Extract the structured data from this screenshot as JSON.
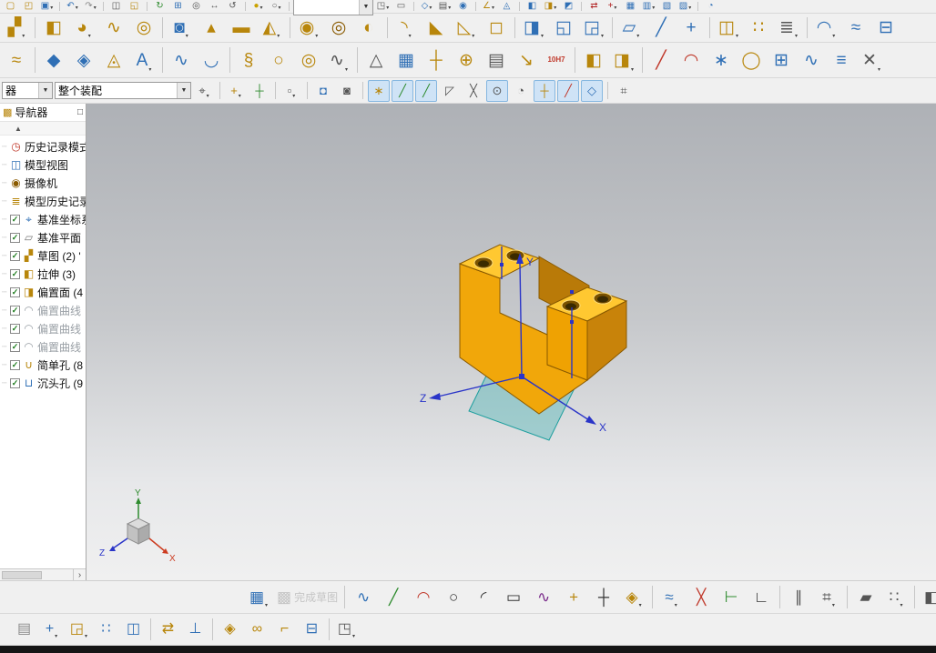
{
  "navigator": {
    "title": "导航器",
    "maximize_glyph": "□",
    "collapse_glyph": "▲",
    "check_glyph": "✓",
    "scroll_right_glyph": "›",
    "header_icon": "▩",
    "items": [
      {
        "name": "history-mode",
        "label": "历史记录模式",
        "glyph": "◷",
        "color": "#c0392b",
        "check": false,
        "gray": false
      },
      {
        "name": "model-views",
        "label": "模型视图",
        "glyph": "◫",
        "color": "#2f6fb5",
        "check": false,
        "gray": false
      },
      {
        "name": "cameras",
        "label": "摄像机",
        "glyph": "◉",
        "color": "#8a5a00",
        "check": false,
        "gray": false
      },
      {
        "name": "model-history",
        "label": "模型历史记录",
        "glyph": "≣",
        "color": "#b8860b",
        "check": false,
        "gray": false
      },
      {
        "name": "datum-csys",
        "label": "基准坐标系",
        "glyph": "⌖",
        "color": "#2f6fb5",
        "check": true,
        "gray": false
      },
      {
        "name": "datum-plane",
        "label": "基准平面",
        "glyph": "▱",
        "color": "#7a7a7a",
        "check": true,
        "gray": false
      },
      {
        "name": "sketch",
        "label": "草图 (2) '",
        "glyph": "▞",
        "color": "#b8860b",
        "check": true,
        "gray": false
      },
      {
        "name": "extrude",
        "label": "拉伸 (3)",
        "glyph": "◧",
        "color": "#b8860b",
        "check": true,
        "gray": false
      },
      {
        "name": "offset-face",
        "label": "偏置面 (4",
        "glyph": "◨",
        "color": "#b8860b",
        "check": true,
        "gray": false
      },
      {
        "name": "offset-curve-1",
        "label": "偏置曲线",
        "glyph": "◠",
        "color": "#9aa0a6",
        "check": true,
        "gray": true
      },
      {
        "name": "offset-curve-2",
        "label": "偏置曲线",
        "glyph": "◠",
        "color": "#9aa0a6",
        "check": true,
        "gray": true
      },
      {
        "name": "offset-curve-3",
        "label": "偏置曲线",
        "glyph": "◠",
        "color": "#9aa0a6",
        "check": true,
        "gray": true
      },
      {
        "name": "simple-hole",
        "label": "简单孔 (8",
        "glyph": "∪",
        "color": "#b8860b",
        "check": true,
        "gray": false
      },
      {
        "name": "counterbore-hole",
        "label": "沉头孔 (9",
        "glyph": "⊔",
        "color": "#2f6fb5",
        "check": true,
        "gray": false
      }
    ]
  },
  "canvas": {
    "axes": {
      "x": "X",
      "y": "Y",
      "z": "Z"
    },
    "triad": {
      "x": "X",
      "y": "Y",
      "z": "Z"
    }
  },
  "toolbars": {
    "row1": {
      "items": [
        {
          "n": "new-icon",
          "g": "▢",
          "c": "#b8860b"
        },
        {
          "n": "open-icon",
          "g": "◰",
          "c": "#b8860b"
        },
        {
          "n": "save-icon",
          "g": "▣",
          "c": "#2f6fb5",
          "dd": true
        },
        {
          "n": "sep"
        },
        {
          "n": "undo-icon",
          "g": "↶",
          "c": "#2f6fb5",
          "dd": true
        },
        {
          "n": "redo-icon",
          "g": "↷",
          "c": "#8a8a8a",
          "dd": true
        },
        {
          "n": "sep"
        },
        {
          "n": "copy-icon",
          "g": "◫",
          "c": "#555555"
        },
        {
          "n": "paste-icon",
          "g": "◱",
          "c": "#b8860b"
        },
        {
          "n": "sep"
        },
        {
          "n": "refresh-icon",
          "g": "↻",
          "c": "#2e8b2e"
        },
        {
          "n": "fit-view-icon",
          "g": "⊞",
          "c": "#2f6fb5"
        },
        {
          "n": "zoom-icon",
          "g": "◎",
          "c": "#555555"
        },
        {
          "n": "pan-icon",
          "g": "↔",
          "c": "#555555"
        },
        {
          "n": "rotate-view-icon",
          "g": "↺",
          "c": "#555555"
        },
        {
          "n": "sep"
        },
        {
          "n": "shaded-view-icon",
          "g": "●",
          "c": "#caa200",
          "dd": true
        },
        {
          "n": "wireframe-view-icon",
          "g": "○",
          "c": "#555555",
          "dd": true
        },
        {
          "n": "sep"
        },
        {
          "n": "quick-search-combo",
          "combo": true,
          "w": 88,
          "text": ""
        },
        {
          "n": "window-icon",
          "g": "◳",
          "c": "#555555",
          "dd": true
        },
        {
          "n": "touch-mode-icon",
          "g": "▭",
          "c": "#555555"
        },
        {
          "n": "sep"
        },
        {
          "n": "datum-icon",
          "g": "◇",
          "c": "#2f6fb5",
          "dd": true
        },
        {
          "n": "layer-icon",
          "g": "▤",
          "c": "#555555",
          "dd": true
        },
        {
          "n": "visibility-icon",
          "g": "◉",
          "c": "#2f6fb5"
        },
        {
          "n": "sep"
        },
        {
          "n": "measure-icon",
          "g": "∠",
          "c": "#b8860b",
          "dd": true
        },
        {
          "n": "analysis-icon",
          "g": "◬",
          "c": "#2f6fb5"
        },
        {
          "n": "sep"
        },
        {
          "n": "blue-cube-icon",
          "g": "◧",
          "c": "#2f6fb5"
        },
        {
          "n": "gold-cube-icon",
          "g": "◨",
          "c": "#b8860b",
          "dd": true
        },
        {
          "n": "part-icon",
          "g": "◩",
          "c": "#2f6fb5"
        },
        {
          "n": "sep"
        },
        {
          "n": "swap-arrows-icon",
          "g": "⇄",
          "c": "#b22222"
        },
        {
          "n": "red-plus-icon",
          "g": "+",
          "c": "#b22222",
          "dd": true
        },
        {
          "n": "grid-blue-icon",
          "g": "▦",
          "c": "#2f6fb5"
        },
        {
          "n": "table-icon",
          "g": "▥",
          "c": "#2f6fb5",
          "dd": true
        },
        {
          "n": "chart-icon",
          "g": "▧",
          "c": "#2f6fb5"
        },
        {
          "n": "notes-icon",
          "g": "▨",
          "c": "#2f6fb5",
          "dd": true
        },
        {
          "n": "sep"
        },
        {
          "n": "help-icon",
          "g": "◔",
          "c": "#2f6fb5"
        }
      ]
    },
    "row2": {
      "items": [
        {
          "n": "direct-sketch-icon",
          "g": "▞",
          "c": "#b8860b",
          "dd": true
        },
        {
          "n": "sep"
        },
        {
          "n": "extrude-icon",
          "g": "◧",
          "c": "#b8860b"
        },
        {
          "n": "revolve-icon",
          "g": "◕",
          "c": "#b8860b",
          "dd": true
        },
        {
          "n": "swept-icon",
          "g": "∿",
          "c": "#b8860b"
        },
        {
          "n": "tube-icon",
          "g": "◎",
          "c": "#b8860b"
        },
        {
          "n": "sep"
        },
        {
          "n": "hole-icon",
          "g": "◙",
          "c": "#2f6fb5",
          "dd": true
        },
        {
          "n": "boss-icon",
          "g": "▴",
          "c": "#b8860b"
        },
        {
          "n": "rib-icon",
          "g": "▬",
          "c": "#b8860b"
        },
        {
          "n": "emboss-icon",
          "g": "◭",
          "c": "#b8860b",
          "dd": true
        },
        {
          "n": "sep"
        },
        {
          "n": "unite-icon",
          "g": "◉",
          "c": "#b8860b",
          "dd": true
        },
        {
          "n": "subtract-icon",
          "g": "◎",
          "c": "#8a5a00"
        },
        {
          "n": "intersect-icon",
          "g": "◐",
          "c": "#b8860b"
        },
        {
          "n": "sep"
        },
        {
          "n": "edge-blend-icon",
          "g": "◝",
          "c": "#b8860b",
          "dd": true
        },
        {
          "n": "chamfer-icon",
          "g": "◣",
          "c": "#b8860b"
        },
        {
          "n": "draft-icon",
          "g": "◺",
          "c": "#b8860b",
          "dd": true
        },
        {
          "n": "shell-icon",
          "g": "◻",
          "c": "#b8860b"
        },
        {
          "n": "sep"
        },
        {
          "n": "offset-face-icon",
          "g": "◨",
          "c": "#2f6fb5",
          "dd": true
        },
        {
          "n": "trim-body-icon",
          "g": "◱",
          "c": "#2f6fb5"
        },
        {
          "n": "split-body-icon",
          "g": "◲",
          "c": "#2f6fb5",
          "dd": true
        },
        {
          "n": "sep"
        },
        {
          "n": "datum-plane-icon",
          "g": "▱",
          "c": "#2f6fb5",
          "dd": true
        },
        {
          "n": "datum-axis-icon",
          "g": "╱",
          "c": "#2f6fb5"
        },
        {
          "n": "point-icon",
          "g": "+",
          "c": "#2f6fb5"
        },
        {
          "n": "sep"
        },
        {
          "n": "mirror-feature-icon",
          "g": "◫",
          "c": "#b8860b",
          "dd": true
        },
        {
          "n": "pattern-feature-icon",
          "g": "∷",
          "c": "#b8860b"
        },
        {
          "n": "more-icon",
          "g": "≣",
          "c": "#555555",
          "dd": true
        },
        {
          "n": "sep"
        },
        {
          "n": "surface-icon",
          "g": "◠",
          "c": "#2f6fb5",
          "dd": true
        },
        {
          "n": "sew-icon",
          "g": "≈",
          "c": "#2f6fb5"
        },
        {
          "n": "thicken-icon",
          "g": "⊟",
          "c": "#2f6fb5"
        }
      ]
    },
    "row3": {
      "items": [
        {
          "n": "sheets-icon",
          "g": "≈",
          "c": "#b8860b"
        },
        {
          "n": "sep"
        },
        {
          "n": "facet-icon",
          "g": "◆",
          "c": "#2f6fb5"
        },
        {
          "n": "xform-icon",
          "g": "◈",
          "c": "#2f6fb5"
        },
        {
          "n": "deform-icon",
          "g": "◬",
          "c": "#b8860b"
        },
        {
          "n": "text-icon",
          "g": "A",
          "c": "#2f6fb5",
          "dd": true
        },
        {
          "n": "sep"
        },
        {
          "n": "project-curve-icon",
          "g": "∿",
          "c": "#2f6fb5"
        },
        {
          "n": "combine-curve-icon",
          "g": "◡",
          "c": "#2f6fb5"
        },
        {
          "n": "sep"
        },
        {
          "n": "helix-icon",
          "g": "§",
          "c": "#b8860b"
        },
        {
          "n": "ring-icon",
          "g": "○",
          "c": "#b8860b"
        },
        {
          "n": "coil-icon",
          "g": "◎",
          "c": "#b8860b"
        },
        {
          "n": "law-curve-icon",
          "g": "∿",
          "c": "#555555",
          "dd": true
        },
        {
          "n": "sep"
        },
        {
          "n": "triangle-icon",
          "g": "△",
          "c": "#555555"
        },
        {
          "n": "mesh-grid-icon",
          "g": "▦",
          "c": "#2f6fb5"
        },
        {
          "n": "cross-icon",
          "g": "┼",
          "c": "#b8860b"
        },
        {
          "n": "gear-icon",
          "g": "⊕",
          "c": "#b8860b"
        },
        {
          "n": "annotation-icon",
          "g": "▤",
          "c": "#555555"
        },
        {
          "n": "leader-icon",
          "g": "↘",
          "c": "#b8860b"
        },
        {
          "n": "tolerance-10h7-label",
          "g": "10H7",
          "c": "#c0392b",
          "text": true
        },
        {
          "n": "sep"
        },
        {
          "n": "block-gold-icon",
          "g": "◧",
          "c": "#b8860b"
        },
        {
          "n": "block-pair-icon",
          "g": "◨",
          "c": "#b8860b",
          "dd": true
        },
        {
          "n": "sep"
        },
        {
          "n": "line-red-icon",
          "g": "╱",
          "c": "#c0392b"
        },
        {
          "n": "arc-red-icon",
          "g": "◠",
          "c": "#c0392b"
        },
        {
          "n": "point-set-icon",
          "g": "∗",
          "c": "#2f6fb5"
        },
        {
          "n": "circle-plus-icon",
          "g": "◯",
          "c": "#b8860b"
        },
        {
          "n": "surface-patch-icon",
          "g": "⊞",
          "c": "#2f6fb5"
        },
        {
          "n": "spline-blue-icon",
          "g": "∿",
          "c": "#2f6fb5"
        },
        {
          "n": "isoline-icon",
          "g": "≡",
          "c": "#2f6fb5"
        },
        {
          "n": "xframe-icon",
          "g": "✕",
          "c": "#555555",
          "dd": true
        }
      ]
    },
    "selection": {
      "items": [
        {
          "n": "filter-combo",
          "combo": true,
          "w": 56,
          "text": "器"
        },
        {
          "n": "scope-combo",
          "combo": true,
          "w": 150,
          "text": "整个装配"
        },
        {
          "n": "snap-settings-icon",
          "g": "⌖",
          "c": "#555555",
          "dd": true
        },
        {
          "n": "sep"
        },
        {
          "n": "create-point-icon",
          "g": "+",
          "c": "#b8860b",
          "dd": true
        },
        {
          "n": "point-dialog-icon",
          "g": "┼",
          "c": "#2e8b2e"
        },
        {
          "n": "sep"
        },
        {
          "n": "box-select-icon",
          "g": "▫",
          "c": "#555555",
          "dd": true
        },
        {
          "n": "sep"
        },
        {
          "n": "shaded-toggle-icon",
          "g": "◘",
          "c": "#2f6fb5"
        },
        {
          "n": "wireframe-toggle-icon",
          "g": "◙",
          "c": "#555555"
        },
        {
          "n": "sep"
        },
        {
          "n": "snap-enable-toggle",
          "g": "∗",
          "c": "#b8860b",
          "pressed": true
        },
        {
          "n": "endpoint-toggle",
          "g": "╱",
          "c": "#2e8b2e",
          "pressed": true
        },
        {
          "n": "midpoint-toggle",
          "g": "╱",
          "c": "#2e8b2e",
          "pressed": true
        },
        {
          "n": "control-point-toggle",
          "g": "◸",
          "c": "#555555",
          "pressed": false
        },
        {
          "n": "intersection-toggle",
          "g": "╳",
          "c": "#555555",
          "pressed": false
        },
        {
          "n": "arc-center-toggle",
          "g": "⊙",
          "c": "#555555",
          "pressed": true
        },
        {
          "n": "quadrant-toggle",
          "g": "◔",
          "c": "#555555",
          "pressed": false
        },
        {
          "n": "existing-point-toggle",
          "g": "┼",
          "c": "#b8860b",
          "pressed": true
        },
        {
          "n": "midline-toggle",
          "g": "╱",
          "c": "#c0392b",
          "pressed": true
        },
        {
          "n": "face-snap-toggle",
          "g": "◇",
          "c": "#2f6fb5",
          "pressed": true
        },
        {
          "n": "sep"
        },
        {
          "n": "grid-snap-icon",
          "g": "⌗",
          "c": "#555555"
        }
      ]
    },
    "sketch": {
      "items": [
        {
          "n": "sketch-task-icon",
          "g": "▦",
          "c": "#2f6fb5",
          "dd": true
        },
        {
          "n": "finish-sketch-button",
          "g": "▩",
          "c": "#9a9a9a",
          "label": "完成草图",
          "disabled": true
        },
        {
          "n": "sep"
        },
        {
          "n": "profile-icon",
          "g": "∿",
          "c": "#2f6fb5"
        },
        {
          "n": "line-icon",
          "g": "╱",
          "c": "#2e8b2e"
        },
        {
          "n": "arc-icon",
          "g": "◠",
          "c": "#c0392b"
        },
        {
          "n": "circle-icon",
          "g": "○",
          "c": "#333333"
        },
        {
          "n": "fillet-icon",
          "g": "◜",
          "c": "#333333"
        },
        {
          "n": "rectangle-icon",
          "g": "▭",
          "c": "#333333"
        },
        {
          "n": "studio-spline-icon",
          "g": "∿",
          "c": "#7b2d8b"
        },
        {
          "n": "point-icon",
          "g": "+",
          "c": "#b8860b"
        },
        {
          "n": "coincident-icon",
          "g": "┼",
          "c": "#333333"
        },
        {
          "n": "pattern-curve-icon",
          "g": "◈",
          "c": "#b8860b",
          "dd": true
        },
        {
          "n": "sep"
        },
        {
          "n": "offset-curve-icon",
          "g": "≈",
          "c": "#2f6fb5",
          "dd": true
        },
        {
          "n": "quick-trim-icon",
          "g": "╳",
          "c": "#c0392b"
        },
        {
          "n": "quick-extend-icon",
          "g": "⊢",
          "c": "#2e8b2e"
        },
        {
          "n": "make-corner-icon",
          "g": "∟",
          "c": "#333333"
        },
        {
          "n": "sep"
        },
        {
          "n": "constraints-icon",
          "g": "∥",
          "c": "#555555"
        },
        {
          "n": "auto-dimension-icon",
          "g": "⌗",
          "c": "#555555",
          "dd": true
        },
        {
          "n": "sep"
        },
        {
          "n": "show-constraints-icon",
          "g": "▰",
          "c": "#555555"
        },
        {
          "n": "pattern-icon",
          "g": "∷",
          "c": "#555555",
          "dd": true
        },
        {
          "n": "sep"
        },
        {
          "n": "orient-sketch-icon",
          "g": "◧",
          "c": "#555555",
          "dd": true
        },
        {
          "n": "target-icon",
          "g": "◨",
          "c": "#2f6fb5"
        }
      ]
    },
    "assembly": {
      "items": [
        {
          "n": "clipboard-icon",
          "g": "▤",
          "c": "#8a8a8a"
        },
        {
          "n": "add-component-icon",
          "g": "+",
          "c": "#2f6fb5",
          "dd": true
        },
        {
          "n": "new-component-icon",
          "g": "◲",
          "c": "#b8860b",
          "dd": true
        },
        {
          "n": "pattern-component-icon",
          "g": "∷",
          "c": "#2f6fb5"
        },
        {
          "n": "mirror-assembly-icon",
          "g": "◫",
          "c": "#2f6fb5"
        },
        {
          "n": "sep"
        },
        {
          "n": "move-component-icon",
          "g": "⇄",
          "c": "#b8860b"
        },
        {
          "n": "assembly-constraints-icon",
          "g": "⊥",
          "c": "#2f6fb5"
        },
        {
          "n": "sep"
        },
        {
          "n": "wave-link-icon",
          "g": "◈",
          "c": "#b8860b"
        },
        {
          "n": "chain-icon",
          "g": "∞",
          "c": "#b8860b"
        },
        {
          "n": "pipe-icon",
          "g": "⌐",
          "c": "#b8860b"
        },
        {
          "n": "fastener-icon",
          "g": "⊟",
          "c": "#2f6fb5"
        },
        {
          "n": "sep"
        },
        {
          "n": "explode-icon",
          "g": "◳",
          "c": "#555555",
          "dd": true
        }
      ]
    }
  }
}
